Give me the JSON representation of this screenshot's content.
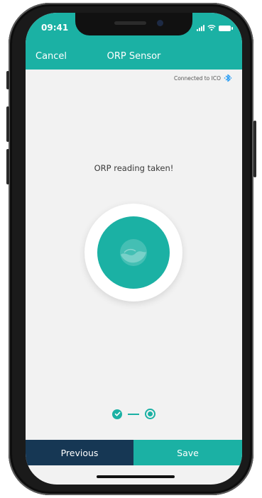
{
  "status_bar": {
    "time": "09:41"
  },
  "header": {
    "cancel_label": "Cancel",
    "title": "ORP Sensor"
  },
  "connection": {
    "text": "Connected to ICO",
    "icon": "bluetooth-icon"
  },
  "main": {
    "message": "ORP reading taken!",
    "sensor_icon": "water-drop-icon"
  },
  "steps": {
    "total": 2,
    "completed": 1,
    "current": 2
  },
  "footer": {
    "previous_label": "Previous",
    "save_label": "Save"
  },
  "colors": {
    "accent": "#1bb1a4",
    "dark": "#163754",
    "background": "#f2f2f2",
    "bluetooth": "#2a9df4"
  }
}
